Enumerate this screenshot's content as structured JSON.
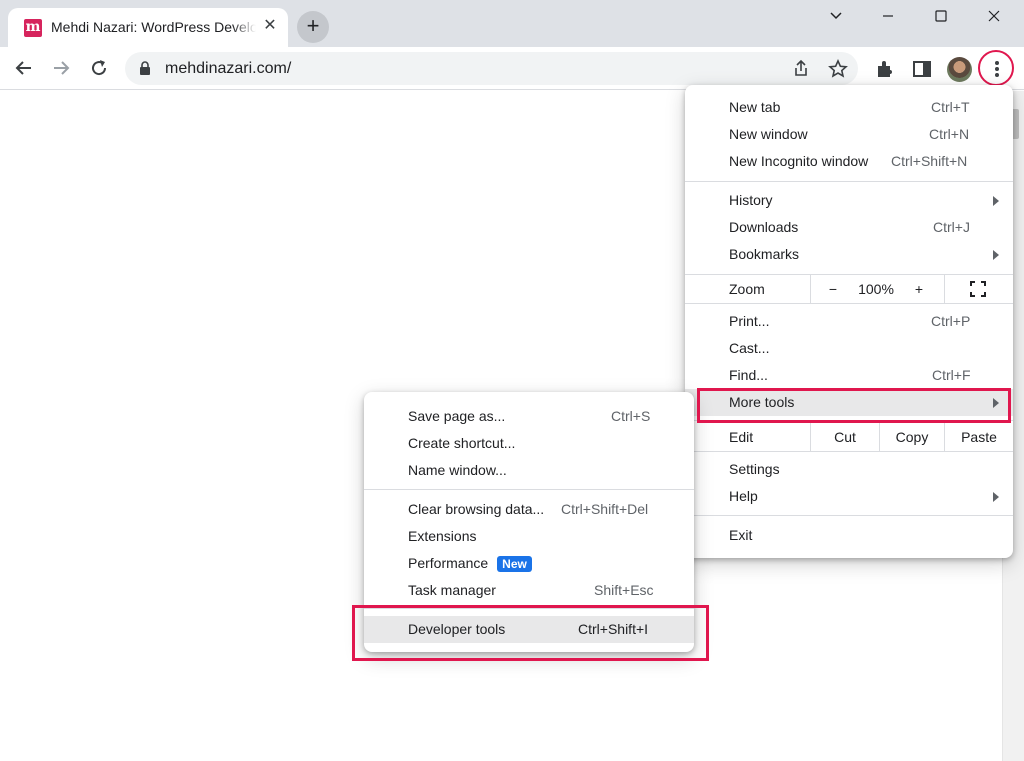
{
  "tab": {
    "favicon": "m",
    "title": "Mehdi Nazari: WordPress Developer",
    "close": "✕"
  },
  "window": {
    "minimize_icon": "chevron-down-icon"
  },
  "address": {
    "url": "mehdinazari.com/"
  },
  "colors": {
    "accent_red": "#e0174e",
    "badge_blue": "#1a73e8",
    "favicon": "#d6245d"
  },
  "main_menu": {
    "group1": [
      {
        "label": "New tab",
        "shortcut": "Ctrl+T"
      },
      {
        "label": "New window",
        "shortcut": "Ctrl+N"
      },
      {
        "label": "New Incognito window",
        "shortcut": "Ctrl+Shift+N"
      }
    ],
    "group2": [
      {
        "label": "History",
        "shortcut": ""
      },
      {
        "label": "Downloads",
        "shortcut": "Ctrl+J"
      },
      {
        "label": "Bookmarks",
        "shortcut": ""
      }
    ],
    "zoom": {
      "label": "Zoom",
      "minus": "−",
      "value": "100%",
      "plus": "+"
    },
    "group3": [
      {
        "label": "Print...",
        "shortcut": "Ctrl+P"
      },
      {
        "label": "Cast...",
        "shortcut": ""
      },
      {
        "label": "Find...",
        "shortcut": "Ctrl+F"
      },
      {
        "label": "More tools",
        "shortcut": ""
      }
    ],
    "edit": {
      "label": "Edit",
      "cut": "Cut",
      "copy": "Copy",
      "paste": "Paste"
    },
    "group4": [
      {
        "label": "Settings",
        "shortcut": ""
      },
      {
        "label": "Help",
        "shortcut": ""
      }
    ],
    "exit": {
      "label": "Exit"
    }
  },
  "sub_menu": {
    "group1": [
      {
        "label": "Save page as...",
        "shortcut": "Ctrl+S"
      },
      {
        "label": "Create shortcut...",
        "shortcut": ""
      },
      {
        "label": "Name window...",
        "shortcut": ""
      }
    ],
    "group2": [
      {
        "label": "Clear browsing data...",
        "shortcut": "Ctrl+Shift+Del"
      },
      {
        "label": "Extensions",
        "shortcut": ""
      },
      {
        "label": "Performance",
        "badge": "New",
        "shortcut": ""
      },
      {
        "label": "Task manager",
        "shortcut": "Shift+Esc"
      }
    ],
    "devtools": {
      "label": "Developer tools",
      "shortcut": "Ctrl+Shift+I"
    }
  }
}
